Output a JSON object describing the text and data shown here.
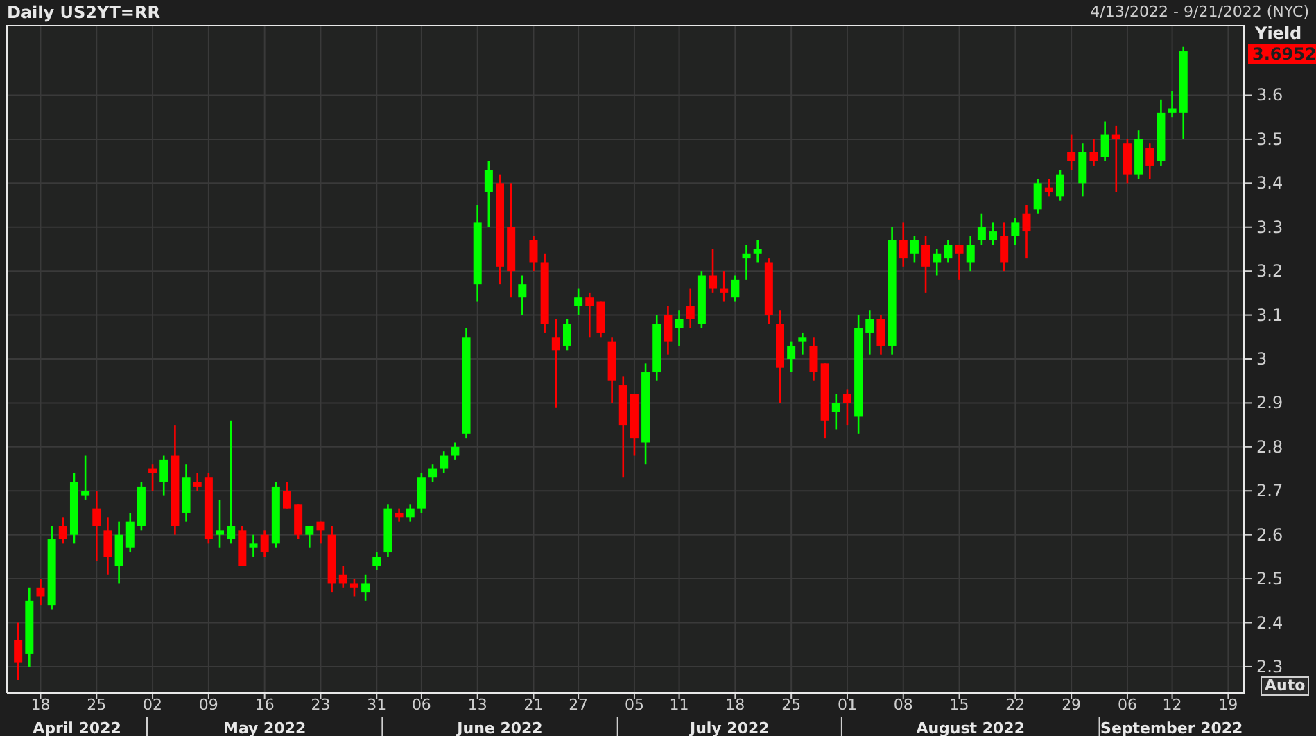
{
  "header": {
    "title": "Daily US2YT=RR",
    "range": "4/13/2022 - 9/21/2022 (NYC)"
  },
  "chart": {
    "last_price": "3.6952",
    "auto_button": "Auto",
    "months": [
      "April 2022",
      "May 2022",
      "June 2022",
      "July 2022",
      "August 2022",
      "September 2022"
    ],
    "chart_data": {
      "type": "candlestick",
      "ylabel": "Yield",
      "grid": true,
      "ylim": [
        2.24,
        3.76
      ],
      "yticks": [
        2.3,
        2.4,
        2.5,
        2.6,
        2.7,
        2.8,
        2.9,
        3,
        3.1,
        3.2,
        3.3,
        3.4,
        3.5,
        3.6
      ],
      "categories": [
        null,
        null,
        "18",
        null,
        null,
        null,
        null,
        "25",
        null,
        null,
        null,
        null,
        "02",
        null,
        null,
        null,
        null,
        "09",
        null,
        null,
        null,
        null,
        "16",
        null,
        null,
        null,
        null,
        "23",
        null,
        null,
        null,
        null,
        "31",
        null,
        null,
        null,
        "06",
        null,
        null,
        null,
        null,
        "13",
        null,
        null,
        null,
        null,
        "21",
        null,
        null,
        null,
        "27",
        null,
        null,
        null,
        null,
        "05",
        null,
        null,
        null,
        "11",
        null,
        null,
        null,
        null,
        "18",
        null,
        null,
        null,
        null,
        "25",
        null,
        null,
        null,
        null,
        "01",
        null,
        null,
        null,
        null,
        "08",
        null,
        null,
        null,
        null,
        "15",
        null,
        null,
        null,
        null,
        "22",
        null,
        null,
        null,
        null,
        "29",
        null,
        null,
        null,
        null,
        "06",
        null,
        null,
        null,
        "12",
        null,
        null,
        null,
        null,
        "19"
      ],
      "ohlc": [
        [
          2.36,
          2.4,
          2.27,
          2.31
        ],
        [
          2.33,
          2.48,
          2.3,
          2.45
        ],
        [
          2.48,
          2.5,
          2.44,
          2.46
        ],
        [
          2.44,
          2.62,
          2.43,
          2.59
        ],
        [
          2.62,
          2.64,
          2.58,
          2.59
        ],
        [
          2.6,
          2.74,
          2.58,
          2.72
        ],
        [
          2.69,
          2.78,
          2.68,
          2.7
        ],
        [
          2.66,
          2.7,
          2.54,
          2.62
        ],
        [
          2.61,
          2.64,
          2.51,
          2.55
        ],
        [
          2.53,
          2.63,
          2.49,
          2.6
        ],
        [
          2.57,
          2.65,
          2.56,
          2.63
        ],
        [
          2.62,
          2.72,
          2.61,
          2.71
        ],
        [
          2.75,
          2.76,
          2.7,
          2.74
        ],
        [
          2.72,
          2.78,
          2.69,
          2.77
        ],
        [
          2.78,
          2.85,
          2.6,
          2.62
        ],
        [
          2.65,
          2.76,
          2.63,
          2.73
        ],
        [
          2.72,
          2.74,
          2.7,
          2.71
        ],
        [
          2.73,
          2.74,
          2.58,
          2.59
        ],
        [
          2.6,
          2.68,
          2.57,
          2.61
        ],
        [
          2.59,
          2.86,
          2.58,
          2.62
        ],
        [
          2.61,
          2.62,
          2.53,
          2.53
        ],
        [
          2.57,
          2.6,
          2.55,
          2.58
        ],
        [
          2.6,
          2.61,
          2.55,
          2.56
        ],
        [
          2.58,
          2.72,
          2.57,
          2.71
        ],
        [
          2.7,
          2.72,
          2.66,
          2.66
        ],
        [
          2.67,
          2.67,
          2.59,
          2.6
        ],
        [
          2.6,
          2.62,
          2.57,
          2.62
        ],
        [
          2.63,
          2.63,
          2.58,
          2.61
        ],
        [
          2.6,
          2.62,
          2.47,
          2.49
        ],
        [
          2.51,
          2.53,
          2.48,
          2.49
        ],
        [
          2.49,
          2.5,
          2.46,
          2.48
        ],
        [
          2.47,
          2.51,
          2.45,
          2.49
        ],
        [
          2.53,
          2.56,
          2.52,
          2.55
        ],
        [
          2.56,
          2.67,
          2.55,
          2.66
        ],
        [
          2.65,
          2.66,
          2.63,
          2.64
        ],
        [
          2.64,
          2.67,
          2.63,
          2.66
        ],
        [
          2.66,
          2.74,
          2.65,
          2.73
        ],
        [
          2.73,
          2.76,
          2.72,
          2.75
        ],
        [
          2.75,
          2.79,
          2.74,
          2.78
        ],
        [
          2.78,
          2.81,
          2.77,
          2.8
        ],
        [
          2.83,
          3.07,
          2.82,
          3.05
        ],
        [
          3.17,
          3.35,
          3.13,
          3.31
        ],
        [
          3.38,
          3.45,
          3.3,
          3.43
        ],
        [
          3.4,
          3.42,
          3.17,
          3.21
        ],
        [
          3.3,
          3.4,
          3.14,
          3.2
        ],
        [
          3.14,
          3.19,
          3.1,
          3.17
        ],
        [
          3.27,
          3.28,
          3.2,
          3.22
        ],
        [
          3.22,
          3.24,
          3.06,
          3.08
        ],
        [
          3.05,
          3.09,
          2.89,
          3.02
        ],
        [
          3.03,
          3.09,
          3.02,
          3.08
        ],
        [
          3.12,
          3.16,
          3.1,
          3.14
        ],
        [
          3.14,
          3.15,
          3.05,
          3.12
        ],
        [
          3.13,
          3.13,
          3.05,
          3.06
        ],
        [
          3.04,
          3.05,
          2.9,
          2.95
        ],
        [
          2.94,
          2.96,
          2.73,
          2.85
        ],
        [
          2.92,
          2.92,
          2.78,
          2.82
        ],
        [
          2.81,
          2.99,
          2.76,
          2.97
        ],
        [
          2.97,
          3.1,
          2.95,
          3.08
        ],
        [
          3.1,
          3.12,
          3.01,
          3.04
        ],
        [
          3.07,
          3.11,
          3.03,
          3.09
        ],
        [
          3.12,
          3.16,
          3.07,
          3.09
        ],
        [
          3.08,
          3.2,
          3.07,
          3.19
        ],
        [
          3.19,
          3.25,
          3.15,
          3.16
        ],
        [
          3.16,
          3.2,
          3.13,
          3.15
        ],
        [
          3.14,
          3.19,
          3.13,
          3.18
        ],
        [
          3.23,
          3.26,
          3.18,
          3.24
        ],
        [
          3.24,
          3.27,
          3.22,
          3.25
        ],
        [
          3.22,
          3.23,
          3.08,
          3.1
        ],
        [
          3.08,
          3.11,
          2.9,
          2.98
        ],
        [
          3.0,
          3.04,
          2.97,
          3.03
        ],
        [
          3.04,
          3.06,
          3.01,
          3.05
        ],
        [
          3.03,
          3.05,
          2.95,
          2.97
        ],
        [
          2.99,
          2.99,
          2.82,
          2.86
        ],
        [
          2.88,
          2.92,
          2.84,
          2.9
        ],
        [
          2.92,
          2.93,
          2.85,
          2.9
        ],
        [
          2.87,
          3.1,
          2.83,
          3.07
        ],
        [
          3.06,
          3.11,
          3.01,
          3.09
        ],
        [
          3.09,
          3.1,
          3.01,
          3.03
        ],
        [
          3.03,
          3.3,
          3.01,
          3.27
        ],
        [
          3.27,
          3.31,
          3.21,
          3.23
        ],
        [
          3.24,
          3.28,
          3.22,
          3.27
        ],
        [
          3.26,
          3.28,
          3.15,
          3.21
        ],
        [
          3.22,
          3.25,
          3.19,
          3.24
        ],
        [
          3.23,
          3.27,
          3.22,
          3.26
        ],
        [
          3.26,
          3.26,
          3.18,
          3.24
        ],
        [
          3.22,
          3.28,
          3.2,
          3.26
        ],
        [
          3.27,
          3.33,
          3.26,
          3.3
        ],
        [
          3.27,
          3.31,
          3.26,
          3.29
        ],
        [
          3.28,
          3.31,
          3.2,
          3.22
        ],
        [
          3.28,
          3.32,
          3.26,
          3.31
        ],
        [
          3.33,
          3.35,
          3.23,
          3.29
        ],
        [
          3.34,
          3.41,
          3.33,
          3.4
        ],
        [
          3.39,
          3.41,
          3.37,
          3.38
        ],
        [
          3.37,
          3.43,
          3.36,
          3.42
        ],
        [
          3.47,
          3.51,
          3.43,
          3.45
        ],
        [
          3.4,
          3.49,
          3.37,
          3.47
        ],
        [
          3.47,
          3.5,
          3.44,
          3.45
        ],
        [
          3.46,
          3.54,
          3.45,
          3.51
        ],
        [
          3.51,
          3.53,
          3.38,
          3.5
        ],
        [
          3.49,
          3.5,
          3.4,
          3.42
        ],
        [
          3.42,
          3.52,
          3.41,
          3.5
        ],
        [
          3.48,
          3.49,
          3.41,
          3.44
        ],
        [
          3.45,
          3.59,
          3.44,
          3.56
        ],
        [
          3.56,
          3.61,
          3.55,
          3.57
        ],
        [
          3.56,
          3.71,
          3.5,
          3.7
        ],
        null,
        null,
        null,
        null
      ]
    }
  }
}
